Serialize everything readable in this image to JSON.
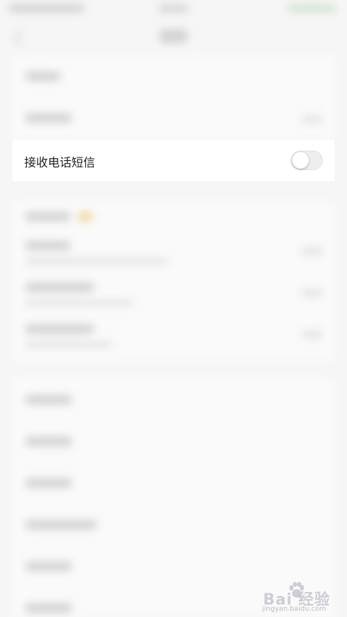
{
  "settings": {
    "receive_sms_label": "接收电话短信",
    "receive_sms_enabled": false
  },
  "watermark": {
    "text": "Bai 经验",
    "url": "jingyan.baidu.com"
  }
}
